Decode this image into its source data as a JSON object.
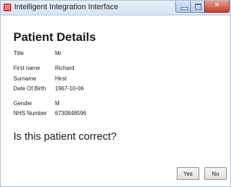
{
  "window": {
    "title": "Intelligent Integration Interface",
    "app_icon_glyph": "⊡",
    "controls": {
      "minimize": "minimize-icon",
      "maximize": "maximize-icon",
      "close": "×"
    }
  },
  "page": {
    "heading": "Patient Details"
  },
  "details": [
    {
      "label": "Title",
      "value": "Mr"
    },
    {
      "label": "First name",
      "value": "Richard"
    },
    {
      "label": "Surname",
      "value": "Hirst"
    },
    {
      "label": "Date Of Birth",
      "value": "1967-10-06"
    },
    {
      "label": "Gender",
      "value": "M"
    },
    {
      "label": "NHS Number",
      "value": "6730848596"
    }
  ],
  "prompt": {
    "question": "Is this patient correct?"
  },
  "buttons": {
    "yes": "Yes",
    "no": "No"
  },
  "colors": {
    "title_bar": "#dbe6f3",
    "close_button": "#c5412b",
    "app_icon": "#d9302b"
  }
}
